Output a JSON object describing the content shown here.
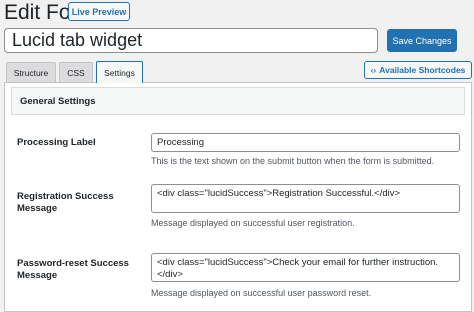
{
  "header": {
    "title": "Edit Form",
    "live_preview_label": "Live Preview",
    "form_name": "Lucid tab widget",
    "save_label": "Save Changes"
  },
  "tabs": [
    {
      "label": "Structure",
      "active": false
    },
    {
      "label": "CSS",
      "active": false
    },
    {
      "label": "Settings",
      "active": true
    }
  ],
  "shortcodes": {
    "icon": "code-brackets-icon",
    "label": "Available Shortcodes"
  },
  "settings": {
    "section_title": "General Settings",
    "processing_label": {
      "label": "Processing Label",
      "value": "Processing",
      "help": "This is the text shown on the submit button when the form is submitted."
    },
    "registration_success": {
      "label": "Registration Success Message",
      "value": "<div class=\"lucidSuccess\">Registration Successful.</div>",
      "help": "Message displayed on successful user registration."
    },
    "password_reset_success": {
      "label": "Password-reset Success Message",
      "value": "<div class=\"lucidSuccess\">Check your email for further instruction.</div>",
      "help": "Message displayed on successful user password reset."
    }
  },
  "colors": {
    "accent": "#2271b1",
    "background": "#f1f1f1",
    "panel": "#ffffff"
  }
}
